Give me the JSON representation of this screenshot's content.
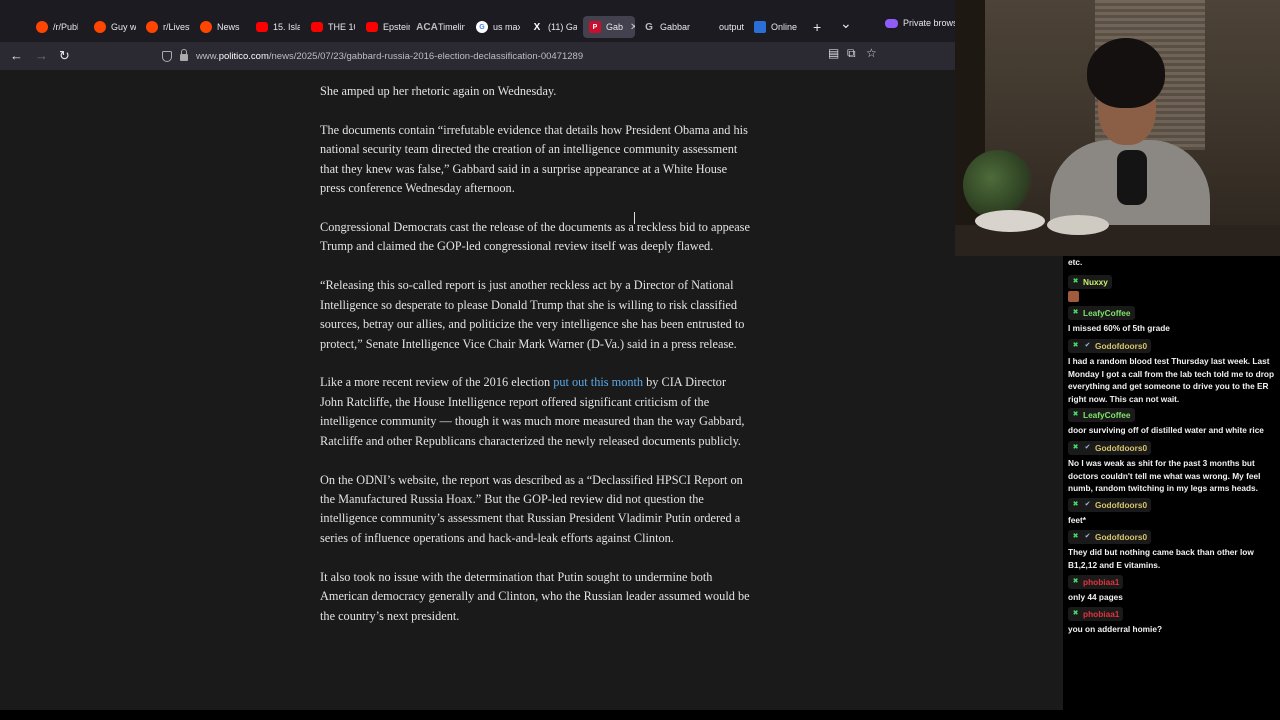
{
  "tabs": [
    {
      "label": "/r/Publ",
      "icon": "reddit-icon"
    },
    {
      "label": "Guy wi",
      "icon": "reddit-icon"
    },
    {
      "label": "r/Livest",
      "icon": "reddit-icon"
    },
    {
      "label": "News",
      "icon": "reddit-icon"
    },
    {
      "label": "15. Isla",
      "icon": "youtube-icon"
    },
    {
      "label": "THE 10",
      "icon": "youtube-icon"
    },
    {
      "label": "Epstein",
      "icon": "youtube-icon"
    },
    {
      "label": "Timelin",
      "icon": "aca-icon",
      "icon_text": "ACA"
    },
    {
      "label": "us max",
      "icon": "google-icon",
      "icon_text": "G"
    },
    {
      "label": "(11) Ga",
      "icon": "x-icon",
      "icon_text": "X"
    },
    {
      "label": "Gab",
      "icon": "politico-icon",
      "icon_text": "P",
      "active": true
    },
    {
      "label": "Gabbar",
      "icon": "grok-icon",
      "icon_text": "G"
    },
    {
      "label": "output",
      "icon": "blank-icon"
    },
    {
      "label": "Online",
      "icon": "docs-icon"
    }
  ],
  "tab_close_glyph": "✕",
  "new_tab_glyph": "+",
  "tab_list_glyph": "⌄",
  "private_label": "Private browsi",
  "nav": {
    "back_glyph": "←",
    "forward_glyph": "→",
    "reload_glyph": "↻",
    "url_prefix": "www.",
    "url_domain": "politico.com",
    "url_path": "/news/2025/07/23/gabbard-russia-2016-election-declassification-00471289",
    "reader_glyph": "▤",
    "screenshot_glyph": "⧉",
    "bookmark_glyph": "☆"
  },
  "article": {
    "p1": "She amped up her rhetoric again on Wednesday.",
    "p2": "The documents contain “irrefutable evidence that details how President Obama and his national security team directed the creation of an intelligence community assessment that they knew was false,” Gabbard said in a surprise appearance at a White House press conference Wednesday afternoon.",
    "p3": "Congressional Democrats cast the release of the documents as a reckless bid to appease Trump and claimed the GOP-led congressional review itself was deeply flawed.",
    "p4": "“Releasing this so-called report is just another reckless act by a Director of National Intelligence so desperate to please Donald Trump that she is willing to risk classified sources, betray our allies, and politicize the very intelligence she has been entrusted to protect,” Senate Intelligence Vice Chair Mark Warner (D-Va.) said in a press release.",
    "p5_before": "Like a more recent review of the 2016 election ",
    "p5_link": "put out this month",
    "p5_after": " by CIA Director John Ratcliffe, the House Intelligence report offered significant criticism of the intelligence community — though it was much more measured than the way Gabbard, Ratcliffe and other Republicans characterized the newly released documents publicly.",
    "p6": "On the ODNI’s website, the report was described as a “Declassified HPSCI Report on the Manufactured Russia Hoax.” But the GOP-led review did not question the intelligence community’s assessment that Russian President Vladimir Putin ordered a series of influence operations and hack-and-leak efforts against Clinton.",
    "p7": "It also took no issue with the determination that Putin sought to undermine both American democracy generally and Clinton, who the Russian leader assumed would be the country’s next president."
  },
  "chat": {
    "top_fragment": "etc.",
    "messages": [
      {
        "user": "Nuxxy",
        "color": "#c9f16e",
        "verified": false,
        "text": ""
      },
      {
        "user": "LeafyCoffee",
        "color": "#7fe36a",
        "verified": false,
        "text": "I missed 60% of 5th grade"
      },
      {
        "user": "Godofdoors0",
        "color": "#d6c36b",
        "verified": true,
        "text": "I had a random blood test Thursday last week. Last Monday I got a call from the lab tech told me to drop everything and get someone to drive you to the ER right now. This can not wait."
      },
      {
        "user": "LeafyCoffee",
        "color": "#7fe36a",
        "verified": false,
        "text": "door surviving off of distilled water and white rice"
      },
      {
        "user": "Godofdoors0",
        "color": "#d6c36b",
        "verified": true,
        "text": "No I was weak as shit for the past 3 months but doctors couldn't tell me what was wrong. My feel numb, random twitching in my legs arms heads."
      },
      {
        "user": "Godofdoors0",
        "color": "#d6c36b",
        "verified": true,
        "text": "feet*"
      },
      {
        "user": "Godofdoors0",
        "color": "#d6c36b",
        "verified": true,
        "text": "They did but nothing came back than other low B1,2,12 and E vitamins."
      },
      {
        "user": "phobiaa1",
        "color": "#e0333f",
        "verified": false,
        "text": "only 44 pages"
      },
      {
        "user": "phobiaa1",
        "color": "#e0333f",
        "verified": false,
        "text": "you on adderral homie?"
      }
    ],
    "badge_glyph": "✖",
    "verified_glyph": "✔"
  }
}
